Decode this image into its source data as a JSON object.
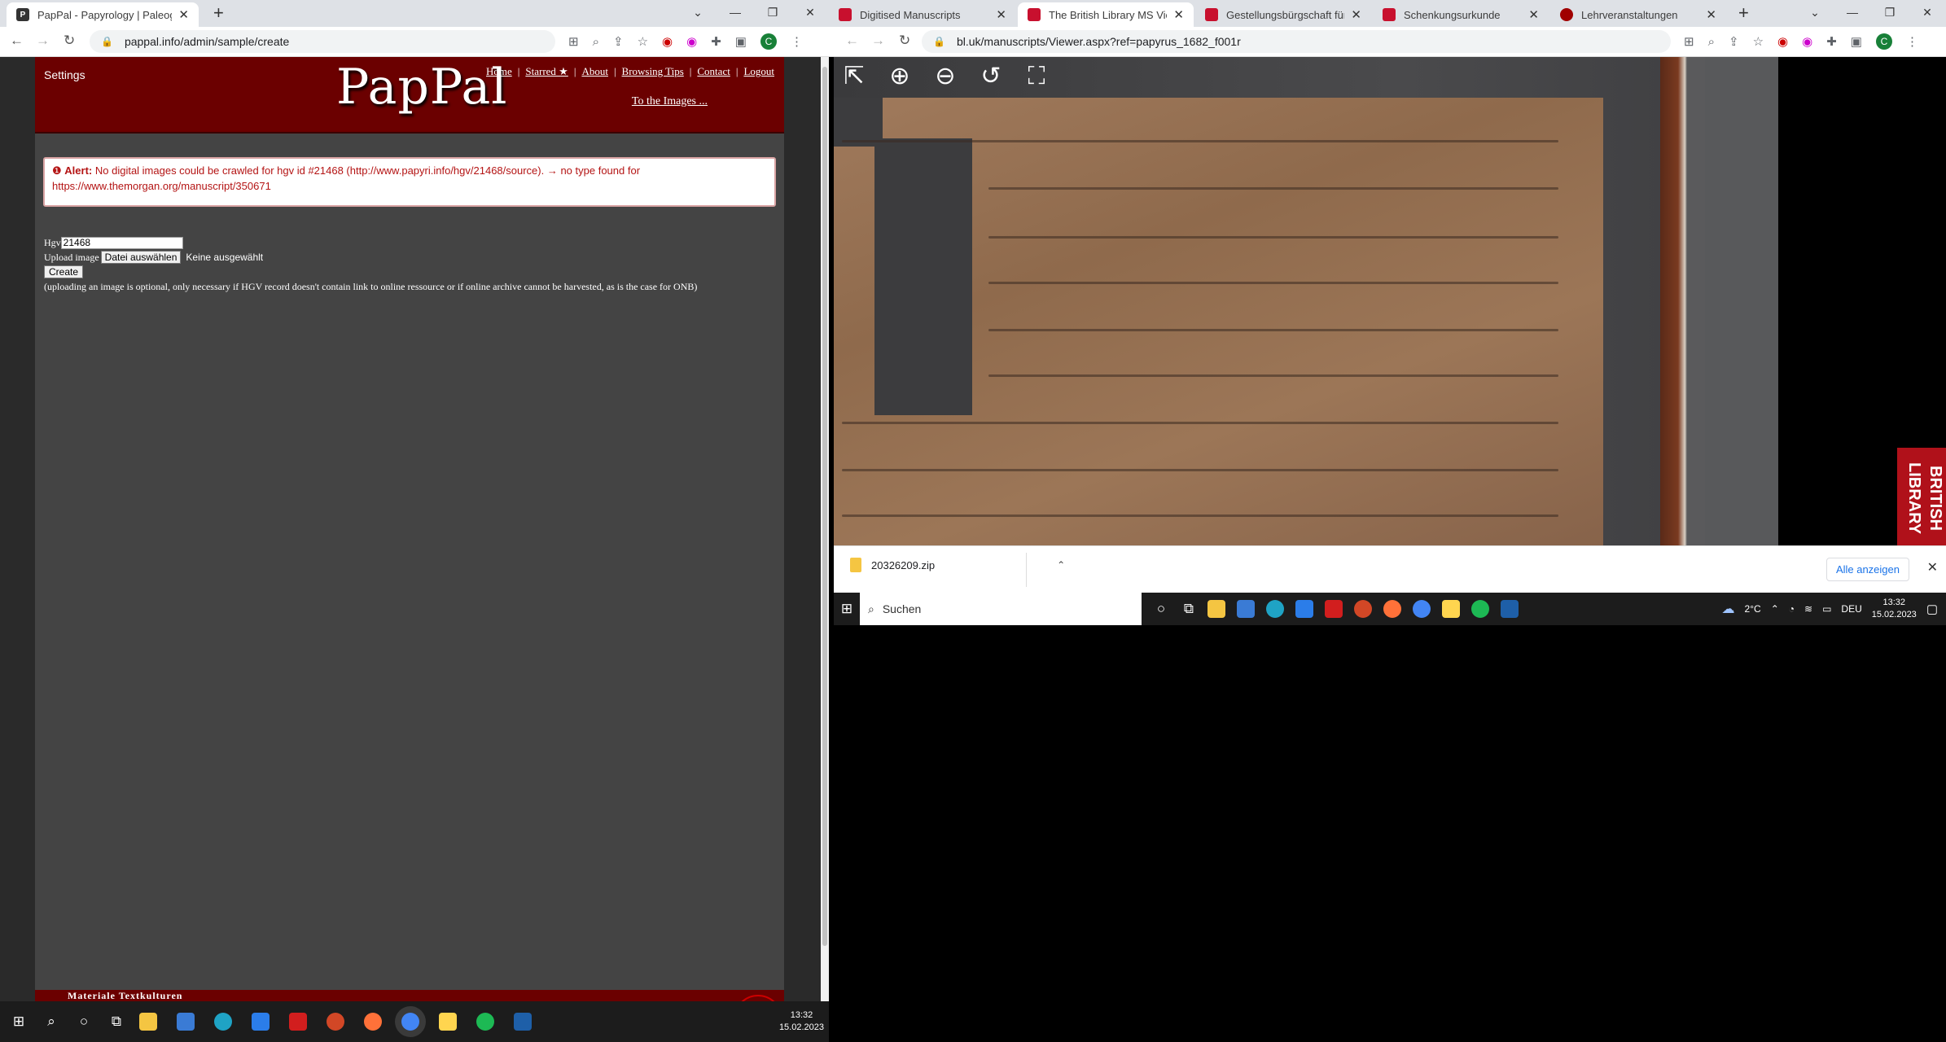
{
  "left_window": {
    "tab": {
      "title": "PapPal - Papyrology | Paleograph",
      "favicon": "P"
    },
    "url": "pappal.info/admin/sample/create",
    "page": {
      "settings": "Settings",
      "logo": "PapPal",
      "nav": [
        "Home",
        "Starred ★",
        "About",
        "Browsing Tips",
        "Contact",
        "Logout"
      ],
      "to_images": "To the Images ...",
      "alert_label": "Alert:",
      "alert_text": "No digital images could be crawled for hgv id #21468 (http://www.papyri.info/hgv/21468/source). → no type found for https://www.themorgan.org/manuscript/350671",
      "hgv_label": "Hgv",
      "hgv_value": "21468",
      "upload_label": "Upload image",
      "file_button": "Datei auswählen",
      "file_none": "Keine ausgewählt",
      "create_button": "Create",
      "note": "(uploading an image is optional, only necessary if HGV record doesn't contain link to online ressource or if online archive cannot be harvested, as is the case for ONB)",
      "footer": "Materiale Textkulturen"
    },
    "taskbar": {
      "time": "13:32",
      "date": "15.02.2023"
    }
  },
  "right_window": {
    "tabs": [
      {
        "title": "Digitised Manuscripts",
        "color": "#c8102e"
      },
      {
        "title": "The British Library MS Viewer",
        "color": "#c8102e",
        "active": true
      },
      {
        "title": "Gestellungsbürgschaft für ein",
        "color": "#c8102e"
      },
      {
        "title": "Schenkungsurkunde",
        "color": "#c8102e"
      },
      {
        "title": "Lehrveranstaltungen",
        "color": "#a00000"
      }
    ],
    "url": "bl.uk/manuscripts/Viewer.aspx?ref=papyrus_1682_f001r",
    "viewer": {
      "logo": "BRITISH LIBRARY"
    },
    "download": {
      "file": "20326209.zip",
      "show_all": "Alle anzeigen"
    },
    "taskbar": {
      "search": "Suchen",
      "weather": "2°C",
      "lang": "DEU",
      "time": "13:32",
      "date": "15.02.2023"
    }
  }
}
